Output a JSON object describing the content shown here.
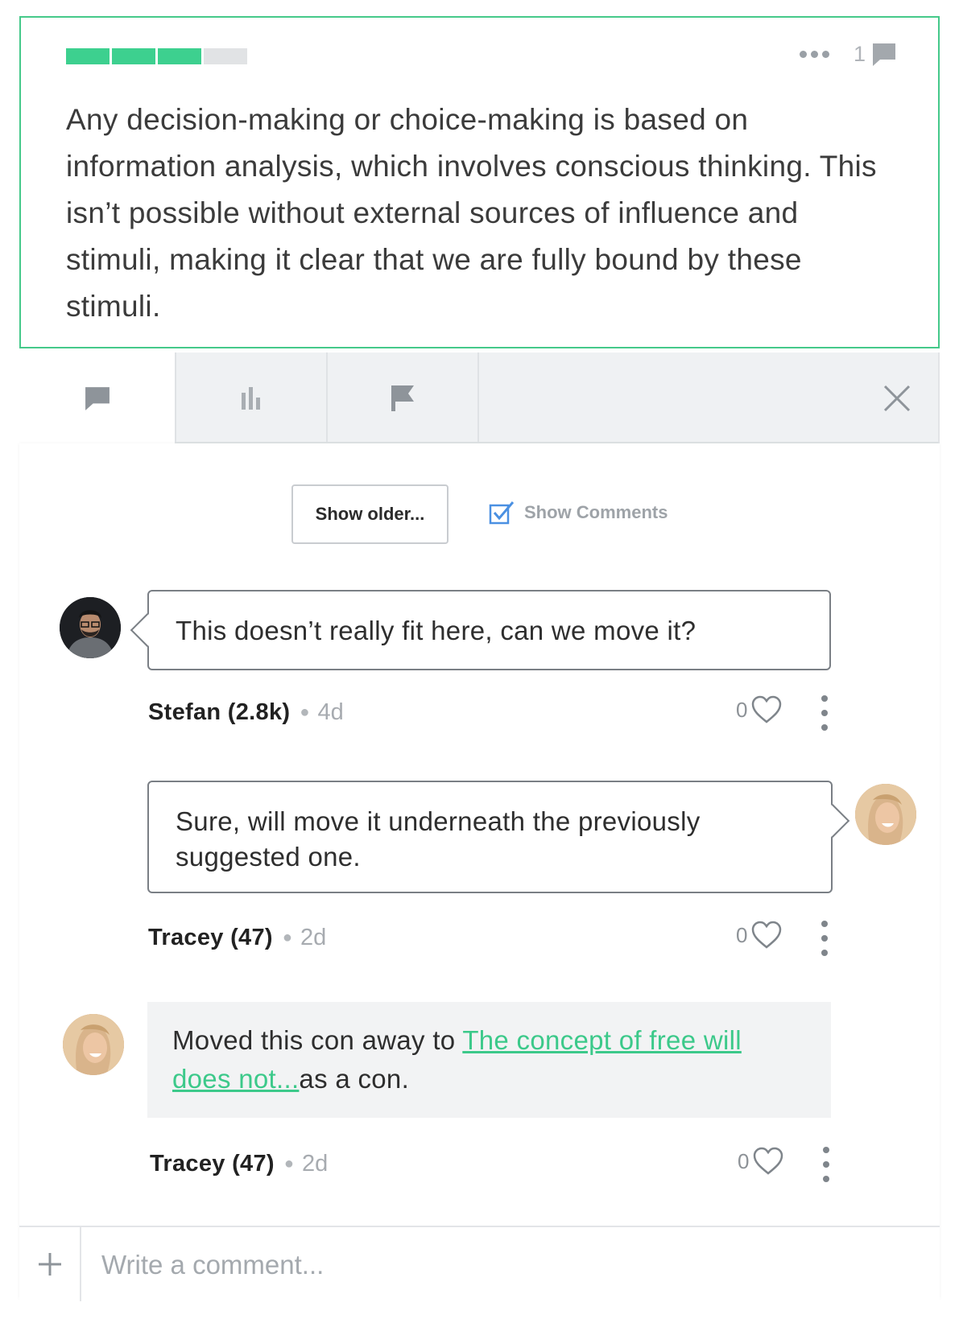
{
  "argument": {
    "strength": 0.75,
    "comment_count": "1",
    "text": "Any decision-making or choice-making is based on information analysis, which involves conscious thinking. This isn’t possible without external sources of influence and stimuli, making it clear that we are fully bound by these stimuli."
  },
  "tabs": [
    {
      "name": "comments",
      "icon": "comment-icon",
      "active": true
    },
    {
      "name": "stats",
      "icon": "bar-chart-icon",
      "active": false
    },
    {
      "name": "flag",
      "icon": "flag-icon",
      "active": false
    }
  ],
  "controls": {
    "show_older_label": "Show older...",
    "show_comments_label": "Show Comments",
    "show_comments_checked": true
  },
  "comments": [
    {
      "author": "Stefan (2.8k)",
      "age": "4d",
      "text": "This doesn’t really fit here, can we move it?",
      "likes": "0"
    },
    {
      "author": "Tracey (47)",
      "age": "2d",
      "text": "Sure, will move it underneath the previously suggested one.",
      "likes": "0"
    },
    {
      "author": "Tracey (47)",
      "age": "2d",
      "text_before": "Moved this con away to ",
      "link": "The concept of free will does not...",
      "text_after": "as a con.",
      "likes": "0"
    }
  ],
  "composer": {
    "placeholder": "Write a comment..."
  },
  "colors": {
    "accent": "#3dd08f",
    "border": "#45c98a",
    "link": "#3cc98a",
    "checkbox": "#4a90e2"
  }
}
